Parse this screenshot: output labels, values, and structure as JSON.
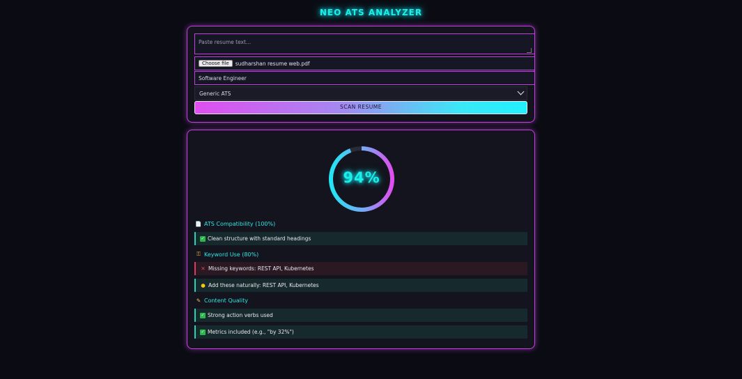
{
  "app": {
    "title": "NEO ATS ANALYZER"
  },
  "form": {
    "resume_placeholder": "Paste resume text...",
    "choose_file_label": "Choose file",
    "file_name": "sudharshan resume web.pdf",
    "job_role_value": "Software Engineer",
    "ats_select_value": "Generic ATS",
    "scan_button_label": "SCAN RESUME"
  },
  "score": {
    "value": 94,
    "label": "94%"
  },
  "colors": {
    "accent_magenta": "#c33fe0",
    "accent_cyan": "#19f0e8",
    "success": "#21d6b8",
    "error": "#e23a5a"
  },
  "sections": [
    {
      "icon": "document-icon",
      "title": "ATS Compatibility (100%)",
      "items": [
        {
          "status": "good",
          "icon": "check-icon",
          "text": "Clean structure with standard headings"
        }
      ]
    },
    {
      "icon": "key-icon",
      "title": "Keyword Use (80%)",
      "items": [
        {
          "status": "bad",
          "icon": "cross-icon",
          "text": "Missing keywords: REST API, Kubernetes"
        },
        {
          "status": "tip",
          "icon": "lightbulb-icon",
          "text": "Add these naturally: REST API, Kubernetes"
        }
      ]
    },
    {
      "icon": "pen-icon",
      "title": "Content Quality",
      "items": [
        {
          "status": "good",
          "icon": "check-icon",
          "text": "Strong action verbs used"
        },
        {
          "status": "good",
          "icon": "check-icon",
          "text": "Metrics included (e.g., \"by 32%\")"
        }
      ]
    }
  ]
}
